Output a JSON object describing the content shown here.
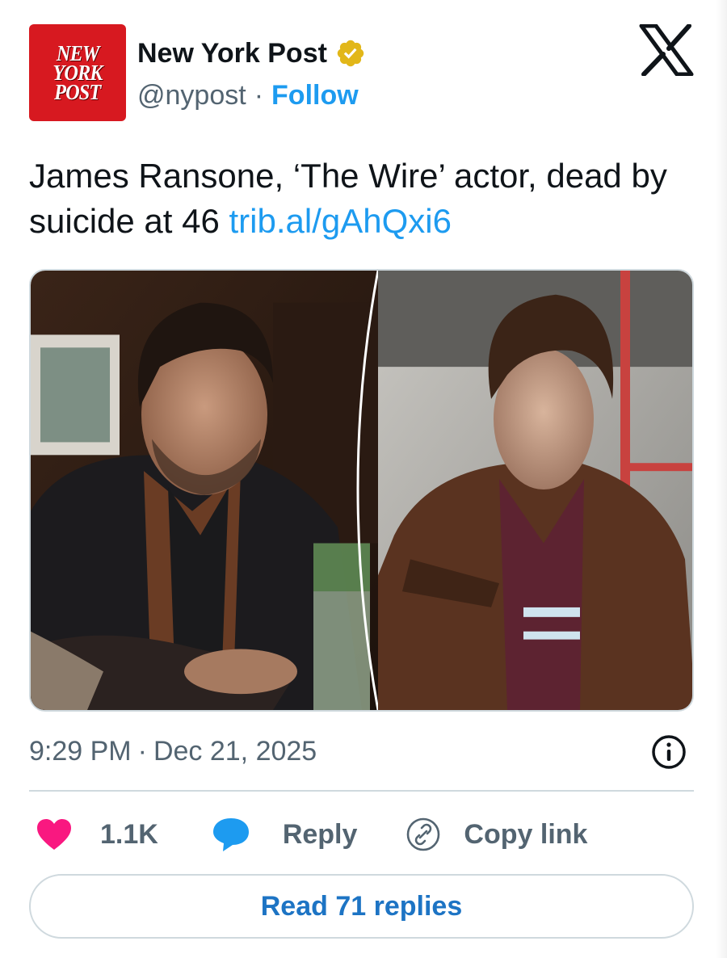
{
  "author": {
    "avatar_lines": [
      "NEW",
      "YORK",
      "POST"
    ],
    "display_name": "New York Post",
    "handle": "@nypost",
    "separator": "·",
    "follow_label": "Follow",
    "verified_badge_color": "#e2b719"
  },
  "tweet": {
    "text": "James Ransone, ‘The Wire’ actor, dead by suicide at 46",
    "link_text": "trib.al/gAhQxi6",
    "timestamp_time": "9:29 PM",
    "separator": "·",
    "timestamp_date": "Dec 21, 2025"
  },
  "actions": {
    "likes_count": "1.1K",
    "reply_label": "Reply",
    "copy_link_label": "Copy link",
    "read_replies_label": "Read 71 replies"
  },
  "icons": {
    "logo": "x-logo-icon",
    "verified": "verified-badge-icon",
    "info": "info-icon",
    "like": "heart-icon",
    "reply": "reply-bubble-icon",
    "copy": "link-icon"
  },
  "colors": {
    "accent": "#1d9bf0",
    "heart": "#f91880",
    "muted": "#536471",
    "avatar_bg": "#d71920"
  }
}
